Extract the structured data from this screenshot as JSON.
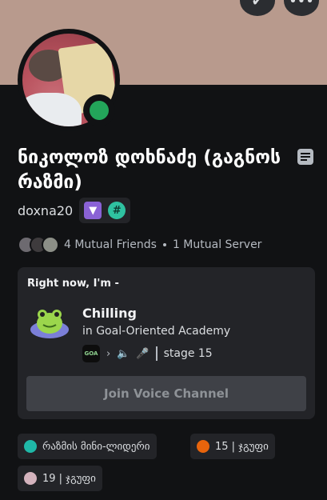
{
  "banner": {
    "color": "#b89a8d"
  },
  "top_buttons": [
    {
      "icon": "add-friend-check-icon",
      "glyph": "✔"
    },
    {
      "icon": "more-icon",
      "glyph": "•••"
    }
  ],
  "profile": {
    "display_name": "ნიკოლოზ დოხნაძე (გაგნოს რაზმი)",
    "username": "doxna20",
    "status": "online",
    "status_color": "#23a55a"
  },
  "badges": [
    {
      "icon": "nitro-badge-icon",
      "glyph": "▼",
      "color": "#8a62d6"
    },
    {
      "icon": "hashtag-badge-icon",
      "glyph": "#",
      "color": "#2fc2a1"
    }
  ],
  "mutuals": {
    "friends": "4 Mutual Friends",
    "servers": "1 Mutual Server"
  },
  "activity": {
    "header": "Right now, I'm -",
    "title": "Chilling",
    "subtitle": "in Goal-Oriented Academy",
    "server_icon_text": "GOA",
    "stage": "stage 15",
    "join_label": "Join Voice Channel"
  },
  "roles": [
    {
      "label": "რაზმის მინი-ლიდერი",
      "color": "#1fb8a8"
    },
    {
      "label": "15 | ჯგუფი",
      "color": "#e8640c"
    },
    {
      "label": "19 | ჯგუფი",
      "color": "#d4b3bd"
    }
  ]
}
